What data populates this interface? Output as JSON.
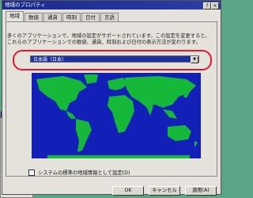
{
  "window": {
    "title": "地域のプロパティ",
    "help_glyph": "?",
    "close_glyph": "×"
  },
  "tabs": [
    {
      "label": "地域"
    },
    {
      "label": "数値"
    },
    {
      "label": "通貨"
    },
    {
      "label": "時刻"
    },
    {
      "label": "日付"
    },
    {
      "label": "言語"
    }
  ],
  "description": "多くのアプリケーションで、地域の設定がサポートされています。この設定を変更すると、これらのアプリケーションでの数値、通貨、時刻および日付の表示方法が変わります。",
  "locale_select": {
    "value": "日本語（日本）",
    "arrow": "▼"
  },
  "checkbox": {
    "label": "システムの標準の地域情報として設定(D)",
    "checked": false
  },
  "buttons": {
    "ok": "OK",
    "cancel": "キャンセル",
    "apply": "適用(A)"
  },
  "colors": {
    "map_ocean": "#1220b8",
    "map_land": "#16b83a",
    "highlight": "#e8162a",
    "title_bar": "#1b2a8c"
  }
}
